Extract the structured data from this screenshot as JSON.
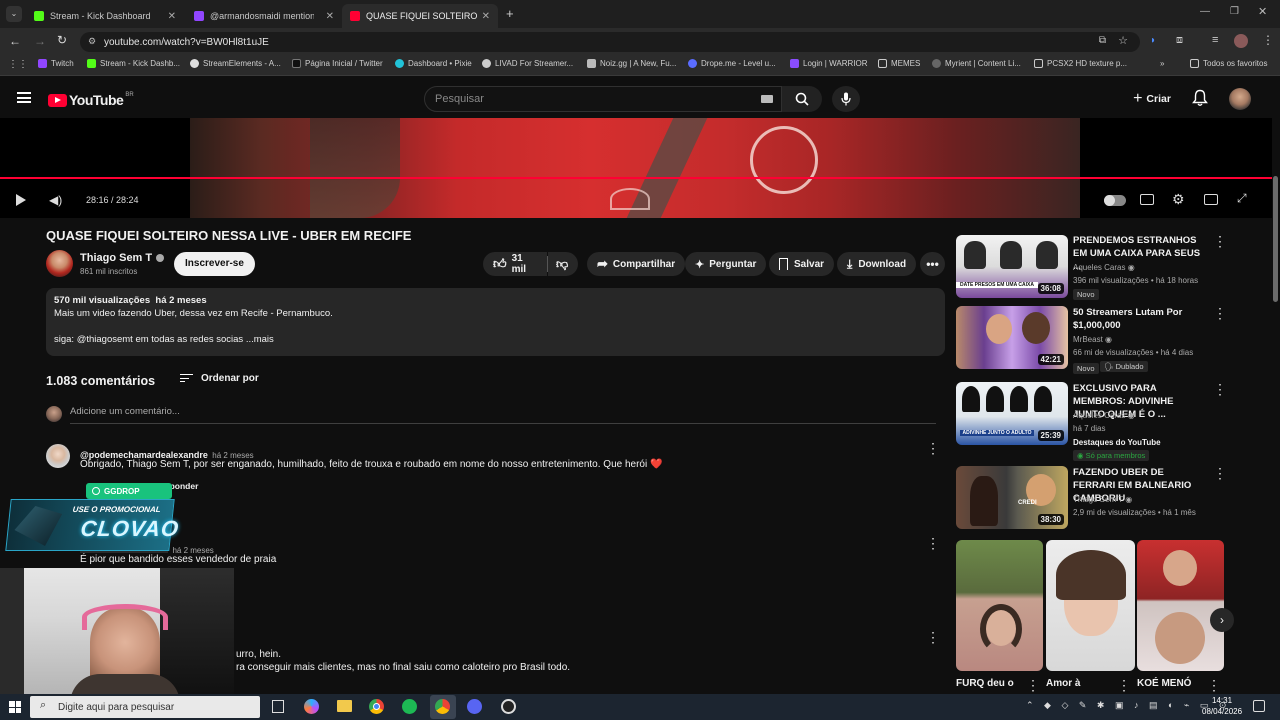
{
  "browser": {
    "tabs": [
      {
        "label": "Stream - Kick Dashboard",
        "color": "#53fc18"
      },
      {
        "label": "@armandosmaidi mentione",
        "color": "#9146ff"
      },
      {
        "label": "QUASE FIQUEI SOLTEIRO NESSA",
        "color": "#ff0033"
      }
    ],
    "url": "youtube.com/watch?v=BW0Hl8t1uJE",
    "bookmarks": [
      "Twitch",
      "Stream - Kick Dashb...",
      "StreamElements - A...",
      "Página Inicial / Twitter",
      "Dashboard • Pixie",
      "LIVAD For Streamer...",
      "Noiz.gg | A New, Fu...",
      "Drope.me - Level u...",
      "Login | WARRIOR",
      "MEMES",
      "Myrient | Content Li...",
      "PCSX2 HD texture p..."
    ],
    "bookmarks_all": "Todos os favoritos"
  },
  "youtube": {
    "logo": "YouTube",
    "region": "BR",
    "search_placeholder": "Pesquisar",
    "create_label": "Criar"
  },
  "player": {
    "time": "28:16 / 28:24"
  },
  "video": {
    "title": "QUASE FIQUEI SOLTEIRO NESSA LIVE - UBER EM RECIFE",
    "channel": "Thiago Sem T",
    "subs": "861 mil inscritos",
    "subscribe": "Inscrever-se",
    "likes": "31 mil",
    "share": "Compartilhar",
    "ask": "Perguntar",
    "save": "Salvar",
    "download": "Download",
    "desc_stats": "570 mil visualizações  há 2 meses",
    "desc_line1": "Mais um video fazendo Uber, dessa vez em Recife - Pernambuco.",
    "desc_line2": "siga: @thiagosemt em todas as redes socias ...mais"
  },
  "comments": {
    "count": "1.083 comentários",
    "sort": "Ordenar por",
    "add_placeholder": "Adicione um comentário...",
    "reply": "Responder",
    "items": [
      {
        "author": "@podemechamardealexandre",
        "time": "há 2 meses",
        "text": "Obrigado, Thiago Sem T, por ser enganado, humilhado, feito de trouxa e roubado em nome do nosso entretenimento. Que herói ❤️"
      },
      {
        "author": "",
        "time": "há 2 meses",
        "text": "É pior que bandido esses vendedor de praia"
      },
      {
        "author": "",
        "time": "",
        "text": "urro, hein."
      },
      {
        "author": "",
        "time": "",
        "text": "ra conseguir mais clientes, mas no final saiu como caloteiro pro Brasil todo."
      }
    ]
  },
  "overlay": {
    "brand": "GGDROP",
    "line1": "USE O PROMOCIONAL",
    "line2": "CLOVAO"
  },
  "related": [
    {
      "title": "PRENDEMOS ESTRANHOS EM UMA CAIXA PARA SEUS ...",
      "channel": "Aqueles Caras",
      "meta": "396 mil visualizações • há 18 horas",
      "badge": "Novo",
      "duration": "36:08",
      "thumb_text": "DATE PRESOS EM UMA CAIXA"
    },
    {
      "title": "50 Streamers Lutam Por $1,000,000",
      "channel": "MrBeast",
      "meta": "66 mi de visualizações • há 4 dias",
      "badge": "Novo",
      "badge2": "Dublado",
      "duration": "42:21"
    },
    {
      "title": "EXCLUSIVO PARA MEMBROS: ADIVINHE JUNTO QUEM É O ...",
      "channel": "Aqueles Caras",
      "meta": "há 7 dias",
      "extra": "Destaques do YouTube",
      "members": "Só para membros",
      "duration": "25:39",
      "thumb_text": "ADIVINHE JUNTO O ADULTO"
    },
    {
      "title": "FAZENDO UBER DE FERRARI EM BALNEARIO CAMBORIU",
      "channel": "Thiago Sem T",
      "meta": "2,9 mi de visualizações • há 1 mês",
      "duration": "38:30",
      "thumb_text": "CREDI"
    }
  ],
  "shorts": [
    {
      "title": "FURQ deu o"
    },
    {
      "title": "Amor à"
    },
    {
      "title": "KOÉ MENÓ"
    }
  ],
  "taskbar": {
    "search": "Digite aqui para pesquisar",
    "time": "14:31",
    "date": "08/04/2026"
  }
}
